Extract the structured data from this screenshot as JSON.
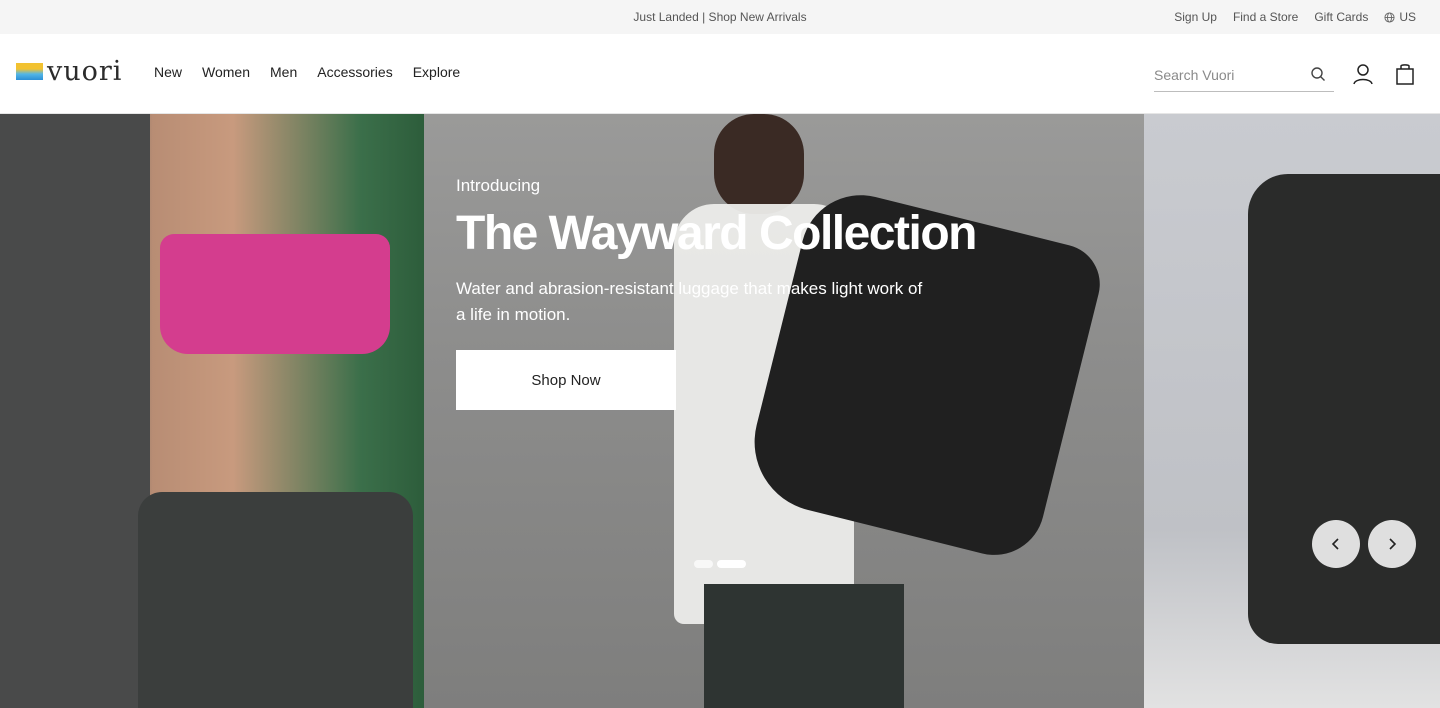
{
  "promo": {
    "text": "Just Landed | Shop New Arrivals"
  },
  "utility": {
    "sign_up": "Sign Up",
    "find_store": "Find a Store",
    "gift_cards": "Gift Cards",
    "region": "US",
    "region_icon": "globe-icon"
  },
  "brand": {
    "name": "vuori",
    "colors": {
      "yellow": "#f2c230",
      "blue": "#2c8fd6"
    }
  },
  "nav": {
    "items": [
      "New",
      "Women",
      "Men",
      "Accessories",
      "Explore"
    ]
  },
  "search": {
    "placeholder": "Search Vuori",
    "icon": "search-icon"
  },
  "header_icons": {
    "account": "user-icon",
    "cart": "shopping-bag-icon"
  },
  "hero": {
    "eyebrow": "Introducing",
    "title": "The Wayward Collection",
    "description": "Water and abrasion-resistant luggage that makes light work of a life in motion.",
    "cta": "Shop Now",
    "slide_count": 2,
    "active_slide": 2
  },
  "carousel": {
    "prev_icon": "chevron-left-icon",
    "next_icon": "chevron-right-icon"
  }
}
